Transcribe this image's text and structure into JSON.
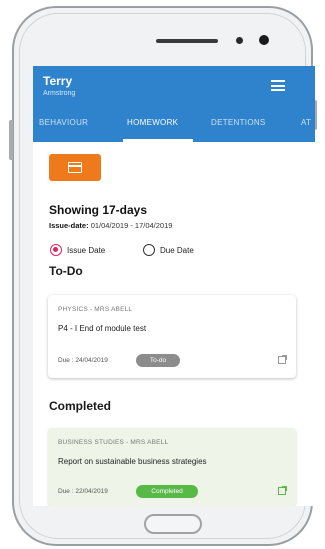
{
  "header": {
    "name": "Terry",
    "subtitle": "Armstrong"
  },
  "tabs": [
    {
      "label": "BEHAVIOUR"
    },
    {
      "label": "HOMEWORK",
      "active": true
    },
    {
      "label": "DETENTIONS"
    },
    {
      "label": "AT"
    }
  ],
  "icons": {
    "menu": "hamburger-menu-icon",
    "calendar": "calendar-icon",
    "open": "external-link-icon"
  },
  "colors": {
    "appbar": "#2f82cc",
    "accent": "#ef7a1c",
    "radio": "#e0245e",
    "completed": "#58b947",
    "todo_badge": "#8c8c8c"
  },
  "filter": {
    "showing": "Showing 17-days",
    "range_label": "Issue-date:",
    "range_value": "01/04/2019 - 17/04/2019",
    "options": [
      {
        "label": "Issue Date",
        "selected": true
      },
      {
        "label": "Due Date",
        "selected": false
      }
    ]
  },
  "todo": {
    "heading": "To-Do",
    "items": [
      {
        "subject": "PHYSICS - MRS ABELL",
        "task": "P4 - I End of module test",
        "due": "Due : 24/04/2019",
        "status": "To-do"
      }
    ]
  },
  "completed": {
    "heading": "Completed",
    "items": [
      {
        "subject": "BUSINESS STUDIES - MRS ABELL",
        "task": "Report on sustainable business strategies",
        "due": "Due : 22/04/2019",
        "status": "Completed"
      }
    ]
  }
}
